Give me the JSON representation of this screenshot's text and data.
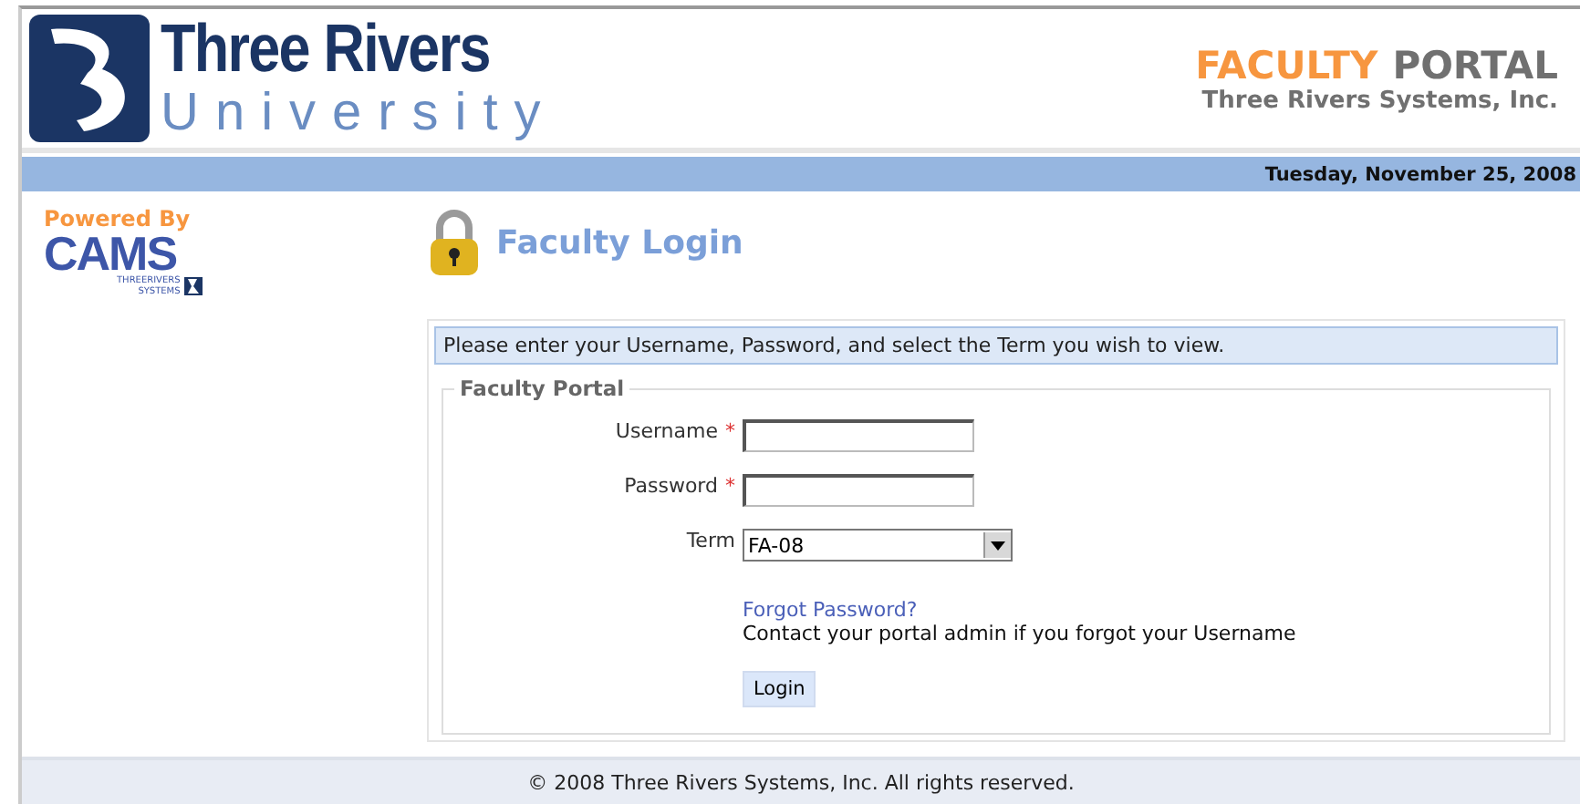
{
  "logo": {
    "line1": "Three Rivers",
    "line2": "University"
  },
  "portal": {
    "word1": "FACULTY",
    "word2": "PORTAL",
    "company": "Three Rivers Systems, Inc."
  },
  "date": "Tuesday, November 25, 2008",
  "powered": {
    "label": "Powered By",
    "brand": "CAMS",
    "sub1": "THREERIVERS",
    "sub2": "SYSTEMS"
  },
  "login": {
    "title": "Faculty Login",
    "instructions": "Please enter your Username, Password, and select the Term you wish to view.",
    "legend": "Faculty Portal",
    "fields": [
      {
        "kind": "text",
        "label": "Username",
        "required": true
      },
      {
        "kind": "password",
        "label": "Password",
        "required": true
      },
      {
        "kind": "select",
        "label": "Term",
        "required": false,
        "value": "FA-08"
      }
    ],
    "required_mark": "*",
    "forgot_link": "Forgot Password?",
    "contact_note": "Contact your portal admin if you forgot your Username",
    "button": "Login"
  },
  "footer": "© 2008 Three Rivers Systems, Inc. All rights reserved."
}
